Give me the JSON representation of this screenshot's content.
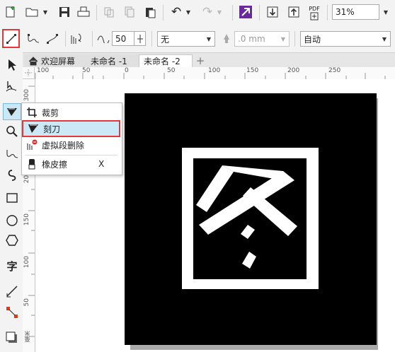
{
  "toolbar": {
    "zoom": "31%",
    "pdf_label": "PDF"
  },
  "propertybar": {
    "smooth_value": "50",
    "outline_select": "无",
    "outline_width": ".0 mm",
    "mode_select": "自动"
  },
  "tabs": [
    {
      "label": "欢迎屏幕"
    },
    {
      "label": "未命名 -1"
    },
    {
      "label": "未命名 -2"
    },
    {
      "label": "+"
    }
  ],
  "ruler": {
    "h_ticks": [
      "100",
      "50",
      "0",
      "50",
      "100",
      "150",
      "200",
      "250"
    ],
    "v_ticks": [
      "300",
      "250",
      "200",
      "150",
      "100",
      "50"
    ],
    "unit": "毫米"
  },
  "flyout": {
    "items": [
      {
        "label": "裁剪",
        "shortcut": ""
      },
      {
        "label": "刻刀",
        "shortcut": ""
      },
      {
        "label": "虚拟段删除",
        "shortcut": ""
      },
      {
        "label": "橡皮擦",
        "shortcut": "X"
      }
    ]
  },
  "colors": {
    "highlight": "#e5363b",
    "selected_item_bg": "#cce8f7",
    "accent": "#7b2ea8"
  }
}
